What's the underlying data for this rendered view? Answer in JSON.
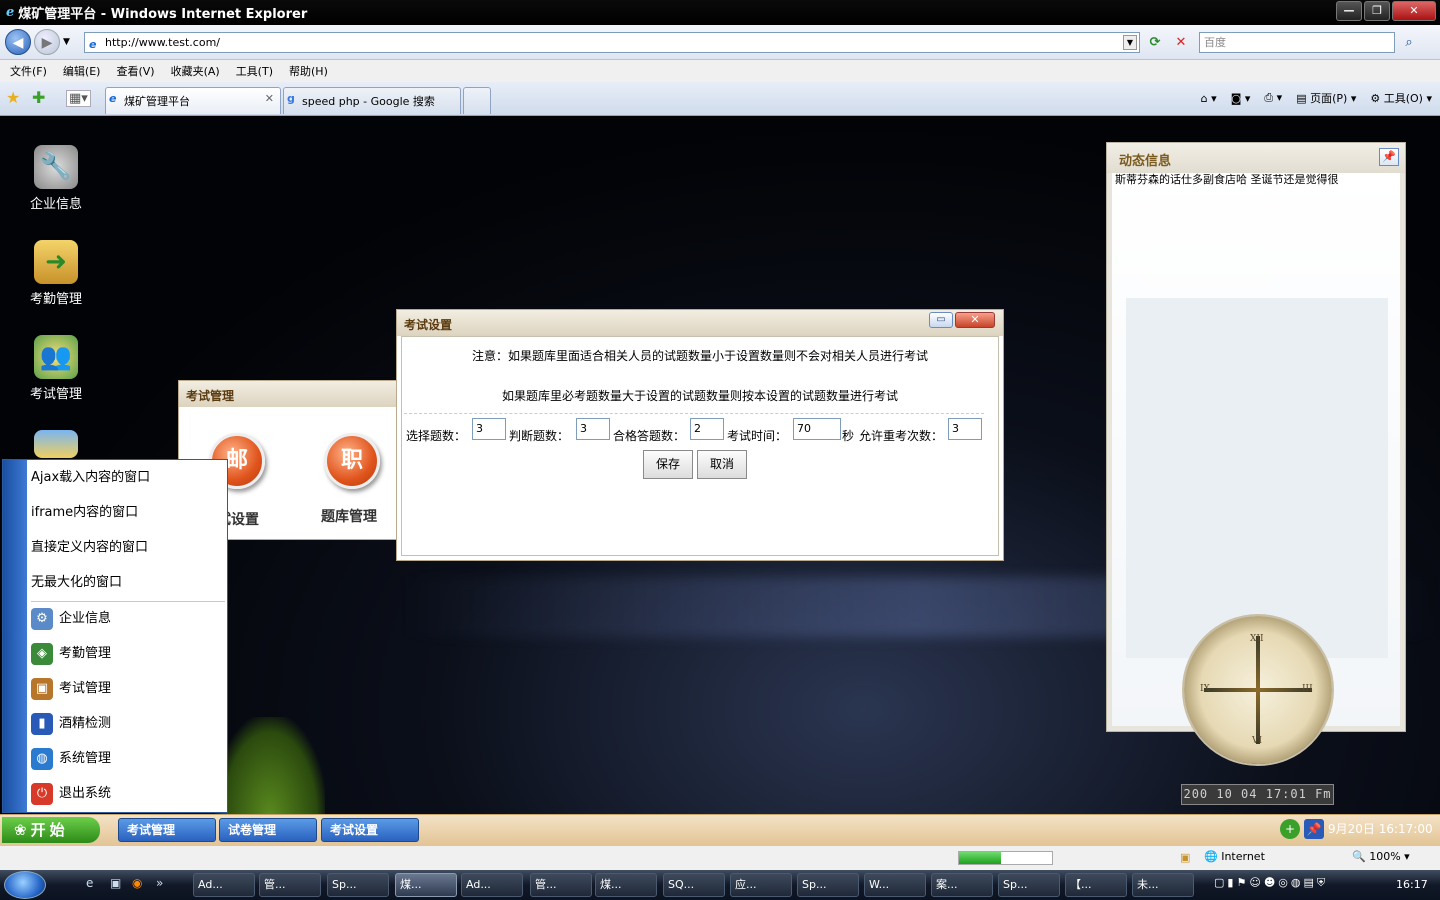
{
  "browser": {
    "window_title": "煤矿管理平台 - Windows Internet Explorer",
    "url": "http://www.test.com/",
    "search_placeholder": "百度",
    "menu": [
      "文件(F)",
      "编辑(E)",
      "查看(V)",
      "收藏夹(A)",
      "工具(T)",
      "帮助(H)"
    ],
    "tabs": [
      {
        "label": "煤矿管理平台",
        "active": true
      },
      {
        "label": "speed php - Google 搜索",
        "active": false
      }
    ],
    "page_menu": "页面(P)",
    "tools_menu": "工具(O)",
    "status_zone": "Internet",
    "zoom": "100%",
    "progress_percent": 45
  },
  "desktop": {
    "icons": [
      {
        "label": "企业信息",
        "icon": "wrench-icon"
      },
      {
        "label": "考勤管理",
        "icon": "folder-arrow-icon"
      },
      {
        "label": "考试管理",
        "icon": "users-icon"
      }
    ]
  },
  "info_panel": {
    "title": "动态信息",
    "text": "斯蒂芬森的话仕多副食店哈  圣诞节还是觉得很"
  },
  "clock": {
    "lcd": "200 10 04 17:01 Fm",
    "numerals": [
      "XII",
      "III",
      "VI",
      "IX"
    ]
  },
  "exam_mgmt_window": {
    "title": "考试管理",
    "items": [
      {
        "label": "试设置",
        "glyph": "邮"
      },
      {
        "label": "题库管理",
        "glyph": "职"
      }
    ]
  },
  "exam_settings_dialog": {
    "title": "考试设置",
    "note1": "注意：如果题库里面适合相关人员的试题数量小于设置数量则不会对相关人员进行考试",
    "note2": "如果题库里必考题数量大于设置的试题数量则按本设置的试题数量进行考试",
    "fields": {
      "choice_label": "选择题数：",
      "choice_value": "3",
      "judge_label": "判断题数：",
      "judge_value": "3",
      "pass_label": "合格答题数：",
      "pass_value": "2",
      "time_label": "考试时间：",
      "time_value": "70",
      "time_unit": "秒",
      "retry_label": "允许重考次数：",
      "retry_value": "3"
    },
    "save_label": "保存",
    "cancel_label": "取消"
  },
  "start_menu": {
    "top_items": [
      "Ajax载入内容的窗口",
      "iframe内容的窗口",
      "直接定义内容的窗口",
      "无最大化的窗口"
    ],
    "items": [
      {
        "label": "企业信息",
        "icon": "enterprise-icon",
        "color": "#5a8ac8"
      },
      {
        "label": "考勤管理",
        "icon": "shield-icon",
        "color": "#3a8a3a"
      },
      {
        "label": "考试管理",
        "icon": "briefcase-icon",
        "color": "#b8762a"
      },
      {
        "label": "酒精检测",
        "icon": "bottle-icon",
        "color": "#2a5ab8"
      },
      {
        "label": "系统管理",
        "icon": "globe-icon",
        "color": "#2a7ad0"
      },
      {
        "label": "退出系统",
        "icon": "power-icon",
        "color": "#d83a2a"
      }
    ]
  },
  "page_taskbar": {
    "start_label": "开始",
    "tasks": [
      "考试管理",
      "试卷管理",
      "考试设置"
    ],
    "datetime": "9月20日 16:17:00"
  },
  "os_taskbar": {
    "tasks": [
      "Ad...",
      "管...",
      "Sp...",
      "煤...",
      "Ad...",
      "管...",
      "煤...",
      "SQ...",
      "应...",
      "Sp...",
      "W...",
      "案...",
      "Sp...",
      "【...",
      "未..."
    ],
    "active_index": 3,
    "clock": "16:17"
  }
}
